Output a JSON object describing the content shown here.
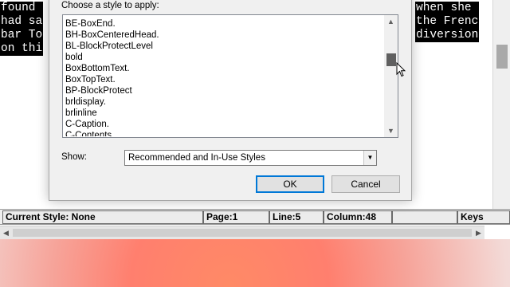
{
  "document": {
    "lines": [
      {
        "left": "found ",
        "right": "when she "
      },
      {
        "left": "had sa",
        "right": "the Frenc"
      },
      {
        "left": "bar To",
        "right": "diversion"
      },
      {
        "left": "on thi",
        "right": ""
      }
    ]
  },
  "dialog": {
    "prompt": "Choose a style to apply:",
    "styles": [
      "BE-BoxEnd.",
      "BH-BoxCenteredHead.",
      "BL-BlockProtectLevel",
      "bold",
      "BoxBottomText.",
      "BoxTopText.",
      "BP-BlockProtect",
      "brldisplay.",
      "brlinline",
      "C-Caption.",
      "C-Contents."
    ],
    "show_label": "Show:",
    "show_value": "Recommended and In-Use Styles",
    "ok_label": "OK",
    "cancel_label": "Cancel"
  },
  "status_bar": {
    "current_style": "Current Style: None",
    "page": "Page:1",
    "line": "Line:5",
    "column": "Column:48",
    "blank": "",
    "keys": "Keys"
  },
  "icons": {
    "list_up": "chevron-up-icon",
    "list_down": "chevron-down-icon",
    "select_arrow": "dropdown-arrow-icon",
    "hscroll_left": "arrow-left-icon",
    "hscroll_right": "arrow-right-icon",
    "cursor": "mouse-pointer-icon"
  },
  "colors": {
    "dialog_bg": "#f0f0f0",
    "ok_border": "#0078d7",
    "highlight": "#000000"
  }
}
